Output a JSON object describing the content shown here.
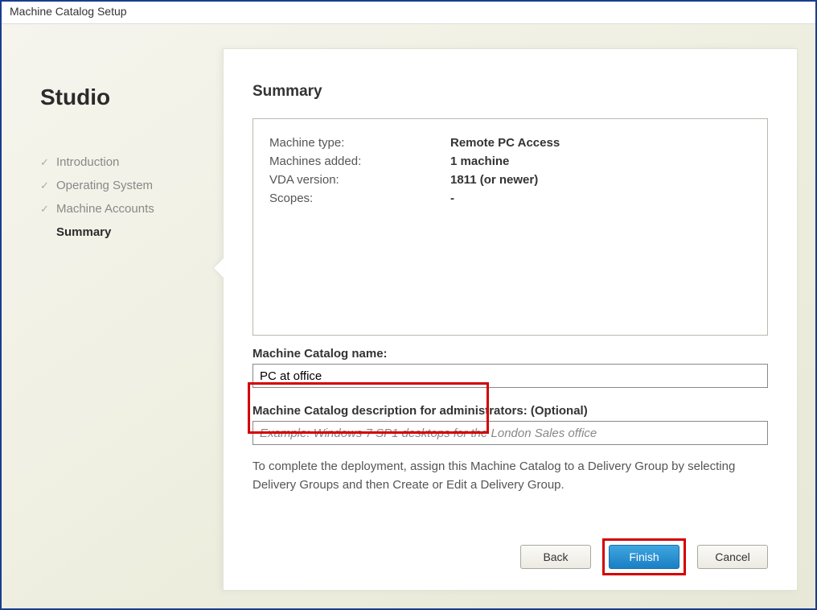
{
  "window": {
    "title": "Machine Catalog Setup"
  },
  "sidebar": {
    "brand": "Studio",
    "steps": [
      {
        "label": "Introduction",
        "done": true,
        "current": false
      },
      {
        "label": "Operating System",
        "done": true,
        "current": false
      },
      {
        "label": "Machine Accounts",
        "done": true,
        "current": false
      },
      {
        "label": "Summary",
        "done": false,
        "current": true
      }
    ]
  },
  "panel": {
    "heading": "Summary",
    "summary": [
      {
        "label": "Machine type:",
        "value": "Remote PC Access"
      },
      {
        "label": "Machines added:",
        "value": "1 machine"
      },
      {
        "label": "VDA version:",
        "value": "1811 (or newer)"
      },
      {
        "label": "Scopes:",
        "value": "-"
      }
    ],
    "nameField": {
      "label": "Machine Catalog name:",
      "value": "PC at office"
    },
    "descField": {
      "label": "Machine Catalog description for administrators: (Optional)",
      "placeholder": "Example: Windows 7 SP1 desktops for the London Sales office",
      "value": ""
    },
    "hint": "To complete the deployment, assign this Machine Catalog to a Delivery Group by selecting Delivery Groups and then Create or Edit a Delivery Group.",
    "buttons": {
      "back": "Back",
      "finish": "Finish",
      "cancel": "Cancel"
    }
  }
}
